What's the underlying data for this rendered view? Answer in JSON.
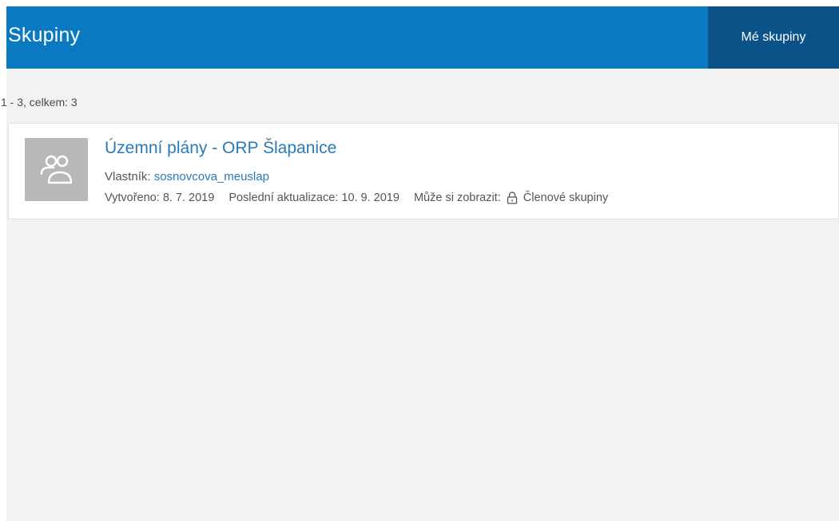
{
  "header": {
    "title": "Skupiny",
    "nav_label": "Mé skupiny"
  },
  "results": {
    "summary": "1 - 3, celkem: 3"
  },
  "groups": [
    {
      "title": "Územní plány - ORP Šlapanice",
      "owner_label": "Vlastník:",
      "owner": "sosnovcova_meuslap",
      "created_label": "Vytvořeno:",
      "created": "8. 7. 2019",
      "updated_label": "Poslední aktualizace:",
      "updated": "10. 9. 2019",
      "visibility_label": "Může si zobrazit:",
      "visibility_icon": "lock-icon",
      "visibility": "Členové skupiny",
      "thumbnail_icon": "group-icon"
    }
  ],
  "colors": {
    "header_bg": "#0a79bf",
    "nav_active_bg": "#0a5288",
    "link": "#2b7ab7",
    "page_bg": "#f2f2f2",
    "thumbnail_bg": "#b9b7b7"
  }
}
